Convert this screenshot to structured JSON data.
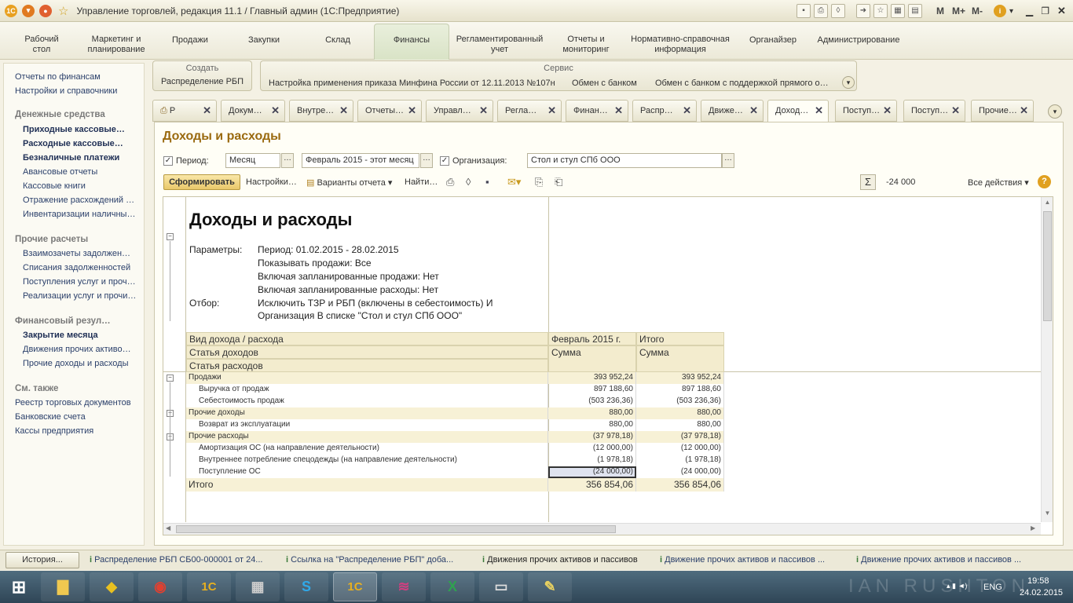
{
  "window": {
    "title": "Управление торговлей, редакция 11.1 / Главный админ  (1С:Предприятие)",
    "zoom_m": "M",
    "zoom_plus": "M+",
    "zoom_minus": "M-"
  },
  "sections": [
    {
      "label": "Рабочий\nстол"
    },
    {
      "label": "Маркетинг и\nпланирование"
    },
    {
      "label": "Продажи"
    },
    {
      "label": "Закупки"
    },
    {
      "label": "Склад"
    },
    {
      "label": "Финансы"
    },
    {
      "label": "Регламентированный\nучет"
    },
    {
      "label": "Отчеты и\nмониторинг"
    },
    {
      "label": "Нормативно-справочная\nинформация"
    },
    {
      "label": "Органайзер"
    },
    {
      "label": "Администрирование"
    }
  ],
  "sidebar": {
    "links": [
      "Отчеты по финансам",
      "Настройки и справочники"
    ],
    "group1": "Денежные средства",
    "g1": [
      "Приходные кассовые…",
      "Расходные кассовые…",
      "Безналичные платежи",
      "Авансовые отчеты",
      "Кассовые книги",
      "Отражение расхождений …",
      "Инвентаризации наличны…"
    ],
    "group2": "Прочие расчеты",
    "g2": [
      "Взаимозачеты задолжен…",
      "Списания задолженностей",
      "Поступления услуг и проч…",
      "Реализации услуг и прочи…"
    ],
    "group3": "Финансовый резул…",
    "g3": [
      "Закрытие месяца",
      "Движения прочих активо…",
      "Прочие доходы и расходы"
    ],
    "group4": "См. также",
    "g4": [
      "Реестр торговых документов",
      "Банковские счета",
      "Кассы предприятия"
    ]
  },
  "create_panel": {
    "title": "Создать",
    "item": "Распределение РБП"
  },
  "service_panel": {
    "title": "Сервис",
    "items": [
      "Настройка применения приказа Минфина России от 12.11.2013 №107н",
      "Обмен с банком",
      "Обмен с банком с поддержкой прямого о…"
    ]
  },
  "tabs": [
    "Р",
    "Докум…",
    "Внутре…",
    "Отчеты…",
    "Управл…",
    "Регла…",
    "Финан…",
    "Распр…",
    "Движе…",
    "Доход…",
    "Поступ…",
    "Поступ…",
    "Прочие…"
  ],
  "form": {
    "title": "Доходы и расходы",
    "period_label": "Период:",
    "period_type": "Месяц",
    "period_value": "Февраль 2015 - этот месяц",
    "org_label": "Организация:",
    "org_value": "Стол и стул СПб ООО",
    "dots": "…"
  },
  "toolbar": {
    "generate": "Сформировать",
    "settings": "Настройки…",
    "variants": "Варианты отчета",
    "find": "Найти…",
    "sum": "-24 000",
    "all_actions": "Все действия"
  },
  "report": {
    "title": "Доходы и расходы",
    "params_label": "Параметры:",
    "params": [
      "Период: 01.02.2015 - 28.02.2015",
      "Показывать продажи: Все",
      "Включая запланированные продажи: Нет",
      "Включая запланированные расходы: Нет"
    ],
    "filter_label": "Отбор:",
    "filter": [
      "Исключить ТЗР и РБП (включены в себестоимость) И",
      "Организация В списке \"Стол и стул СПб ООО\""
    ],
    "headers": {
      "col0": [
        "Вид дохода / расхода",
        "Статья доходов",
        "Статья расходов"
      ],
      "col1": [
        "Февраль 2015 г.",
        "Сумма"
      ],
      "col2": [
        "Итого",
        "Сумма"
      ]
    },
    "rows": [
      {
        "name": "Продажи",
        "v1": "393 952,24",
        "v2": "393 952,24",
        "group": true
      },
      {
        "name": "Выручка от продаж",
        "v1": "897 188,60",
        "v2": "897 188,60",
        "group": false
      },
      {
        "name": "Себестоимость продаж",
        "v1": "(503 236,36)",
        "v2": "(503 236,36)",
        "group": false
      },
      {
        "name": "Прочие доходы",
        "v1": "880,00",
        "v2": "880,00",
        "group": true
      },
      {
        "name": "Возврат из эксплуатации",
        "v1": "880,00",
        "v2": "880,00",
        "group": false
      },
      {
        "name": "Прочие расходы",
        "v1": "(37 978,18)",
        "v2": "(37 978,18)",
        "group": true
      },
      {
        "name": "Амортизация ОС (на направление деятельности)",
        "v1": "(12 000,00)",
        "v2": "(12 000,00)",
        "group": false
      },
      {
        "name": "Внутреннее потребление спецодежды (на направление деятельности)",
        "v1": "(1 978,18)",
        "v2": "(1 978,18)",
        "group": false
      },
      {
        "name": "Поступление ОС",
        "v1": "(24 000,00)",
        "v2": "(24 000,00)",
        "group": false
      }
    ],
    "total": {
      "name": "Итого",
      "v1": "356 854,06",
      "v2": "356 854,06"
    }
  },
  "statusbar": {
    "history": "История...",
    "items": [
      "Распределение РБП СБ00-000001 от 24...",
      "Ссылка на \"Распределение РБП\" доба...",
      "Движения прочих активов и пассивов",
      "Движение прочих активов и пассивов ...",
      "Движение прочих активов и пассивов ..."
    ]
  },
  "taskbar": {
    "lang": "ENG",
    "time": "19:58",
    "date": "24.02.2015",
    "watermark": "IAN RUSHTON"
  }
}
